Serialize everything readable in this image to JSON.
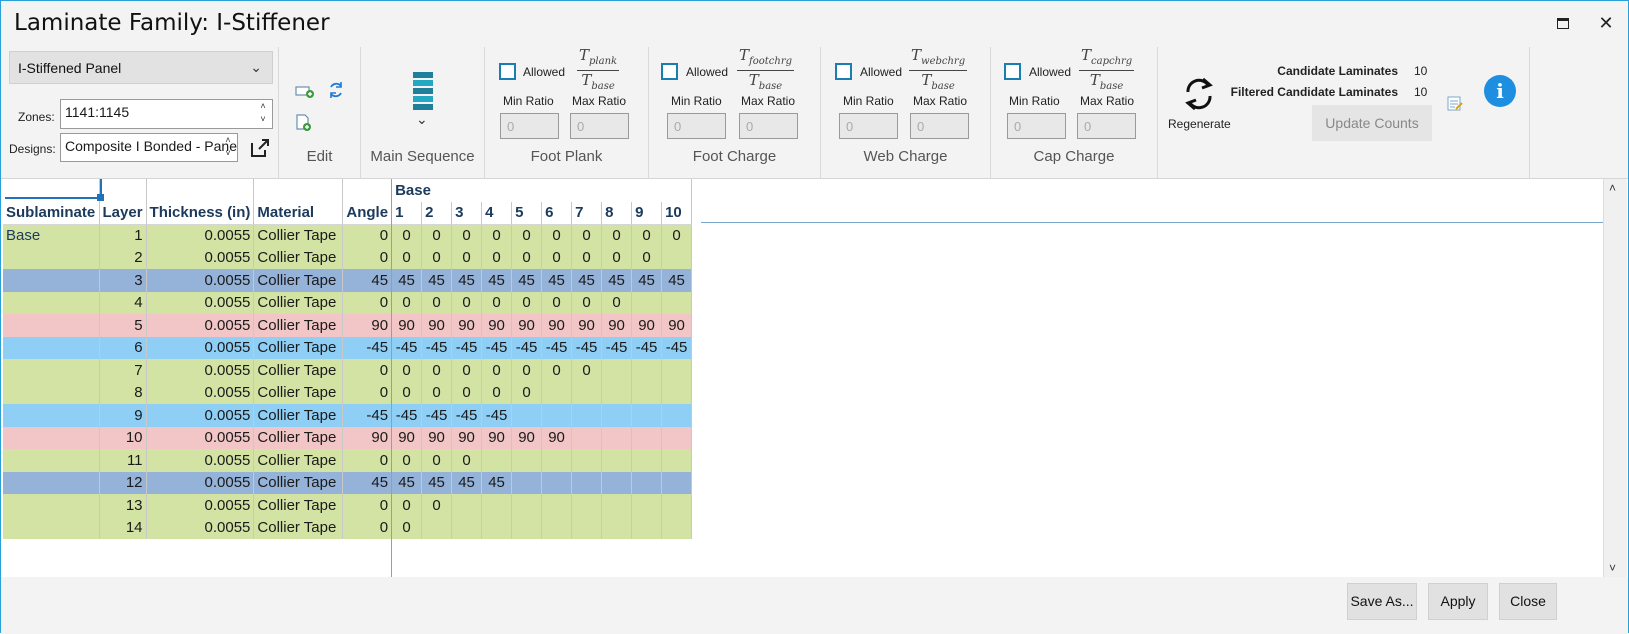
{
  "window": {
    "title": "Laminate Family: I-Stiffener",
    "maximize_icon": "maximize-icon",
    "close_icon": "close-icon",
    "close_glyph": "✕"
  },
  "ribbon": {
    "family_select": "I-Stiffened Panel",
    "zones_label": "Zones:",
    "zones_value": "1141:1145",
    "designs_label": "Designs:",
    "designs_value": "Composite I Bonded - Panel Sizing",
    "edit_label": "Edit",
    "main_sequence_label": "Main Sequence",
    "ratio_groups": [
      {
        "label": "Foot Plank",
        "allowed": "Allowed",
        "numerator": "T",
        "numerator_sub": "plank",
        "denominator": "T",
        "denominator_sub": "base",
        "min_label": "Min Ratio",
        "max_label": "Max Ratio",
        "min_value": "0",
        "max_value": "0"
      },
      {
        "label": "Foot Charge",
        "allowed": "Allowed",
        "numerator": "T",
        "numerator_sub": "footchrg",
        "denominator": "T",
        "denominator_sub": "base",
        "min_label": "Min Ratio",
        "max_label": "Max Ratio",
        "min_value": "0",
        "max_value": "0"
      },
      {
        "label": "Web Charge",
        "allowed": "Allowed",
        "numerator": "T",
        "numerator_sub": "webchrg",
        "denominator": "T",
        "denominator_sub": "base",
        "min_label": "Min Ratio",
        "max_label": "Max Ratio",
        "min_value": "0",
        "max_value": "0"
      },
      {
        "label": "Cap Charge",
        "allowed": "Allowed",
        "numerator": "T",
        "numerator_sub": "capchrg",
        "denominator": "T",
        "denominator_sub": "base",
        "min_label": "Min Ratio",
        "max_label": "Max Ratio",
        "min_value": "0",
        "max_value": "0"
      }
    ],
    "regenerate_label": "Regenerate",
    "candidate_label": "Candidate Laminates",
    "candidate_value": "10",
    "filtered_label": "Filtered Candidate Laminates",
    "filtered_value": "10",
    "update_counts": "Update Counts",
    "info_glyph": "i"
  },
  "grid": {
    "group_header": "Base",
    "columns": [
      "Sublaminate",
      "Layer",
      "Thickness (in)",
      "Material",
      "Angle",
      "1",
      "2",
      "3",
      "4",
      "5",
      "6",
      "7",
      "8",
      "9",
      "10"
    ],
    "rows": [
      {
        "sub": "Base",
        "layer": "1",
        "thk": "0.0055",
        "mat": "Collier Tape",
        "angle": "0",
        "color": "green",
        "cells": [
          "0",
          "0",
          "0",
          "0",
          "0",
          "0",
          "0",
          "0",
          "0",
          "0"
        ]
      },
      {
        "sub": "",
        "layer": "2",
        "thk": "0.0055",
        "mat": "Collier Tape",
        "angle": "0",
        "color": "green",
        "cells": [
          "0",
          "0",
          "0",
          "0",
          "0",
          "0",
          "0",
          "0",
          "0",
          ""
        ]
      },
      {
        "sub": "",
        "layer": "3",
        "thk": "0.0055",
        "mat": "Collier Tape",
        "angle": "45",
        "color": "blue",
        "cells": [
          "45",
          "45",
          "45",
          "45",
          "45",
          "45",
          "45",
          "45",
          "45",
          "45"
        ]
      },
      {
        "sub": "",
        "layer": "4",
        "thk": "0.0055",
        "mat": "Collier Tape",
        "angle": "0",
        "color": "green",
        "cells": [
          "0",
          "0",
          "0",
          "0",
          "0",
          "0",
          "0",
          "0",
          "",
          ""
        ]
      },
      {
        "sub": "",
        "layer": "5",
        "thk": "0.0055",
        "mat": "Collier Tape",
        "angle": "90",
        "color": "pink",
        "cells": [
          "90",
          "90",
          "90",
          "90",
          "90",
          "90",
          "90",
          "90",
          "90",
          "90"
        ]
      },
      {
        "sub": "",
        "layer": "6",
        "thk": "0.0055",
        "mat": "Collier Tape",
        "angle": "-45",
        "color": "cyan",
        "cells": [
          "-45",
          "-45",
          "-45",
          "-45",
          "-45",
          "-45",
          "-45",
          "-45",
          "-45",
          "-45"
        ]
      },
      {
        "sub": "",
        "layer": "7",
        "thk": "0.0055",
        "mat": "Collier Tape",
        "angle": "0",
        "color": "green",
        "cells": [
          "0",
          "0",
          "0",
          "0",
          "0",
          "0",
          "0",
          "",
          "",
          ""
        ]
      },
      {
        "sub": "",
        "layer": "8",
        "thk": "0.0055",
        "mat": "Collier Tape",
        "angle": "0",
        "color": "green",
        "cells": [
          "0",
          "0",
          "0",
          "0",
          "0",
          "",
          "",
          "",
          "",
          ""
        ]
      },
      {
        "sub": "",
        "layer": "9",
        "thk": "0.0055",
        "mat": "Collier Tape",
        "angle": "-45",
        "color": "cyan",
        "cells": [
          "-45",
          "-45",
          "-45",
          "-45",
          "",
          "",
          "",
          "",
          "",
          ""
        ]
      },
      {
        "sub": "",
        "layer": "10",
        "thk": "0.0055",
        "mat": "Collier Tape",
        "angle": "90",
        "color": "pink",
        "cells": [
          "90",
          "90",
          "90",
          "90",
          "90",
          "90",
          "",
          "",
          "",
          ""
        ]
      },
      {
        "sub": "",
        "layer": "11",
        "thk": "0.0055",
        "mat": "Collier Tape",
        "angle": "0",
        "color": "green",
        "cells": [
          "0",
          "0",
          "0",
          "",
          "",
          "",
          "",
          "",
          "",
          ""
        ]
      },
      {
        "sub": "",
        "layer": "12",
        "thk": "0.0055",
        "mat": "Collier Tape",
        "angle": "45",
        "color": "blue",
        "cells": [
          "45",
          "45",
          "45",
          "45",
          "",
          "",
          "",
          "",
          "",
          ""
        ]
      },
      {
        "sub": "",
        "layer": "13",
        "thk": "0.0055",
        "mat": "Collier Tape",
        "angle": "0",
        "color": "green",
        "cells": [
          "0",
          "0",
          "",
          "",
          "",
          "",
          "",
          "",
          "",
          ""
        ]
      },
      {
        "sub": "",
        "layer": "14",
        "thk": "0.0055",
        "mat": "Collier Tape",
        "angle": "0",
        "color": "green",
        "cells": [
          "0",
          "",
          "",
          "",
          "",
          "",
          "",
          "",
          "",
          ""
        ]
      }
    ]
  },
  "footer": {
    "save_as": "Save As...",
    "apply": "Apply",
    "close": "Close"
  },
  "colors": {
    "green": "#d3e3a4",
    "blue": "#95b2d8",
    "pink": "#f2c6c6",
    "cyan": "#8fcff6",
    "accent": "#2aa0d8"
  }
}
